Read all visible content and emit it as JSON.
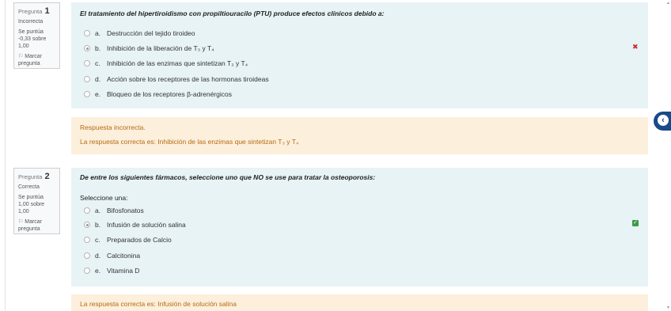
{
  "questions": [
    {
      "label": "Pregunta",
      "number": "1",
      "state": "Incorrecta",
      "grade": "Se puntúa -0,33 sobre 1,00",
      "flag": "Marcar pregunta",
      "text": "El tratamiento del hipertiroidismo con propiltiouracilo (PTU) produce efectos clínicos debido a:",
      "prompt": "",
      "options": [
        {
          "letter": "a.",
          "text": "Destrucción del tejido tiroideo",
          "checked": false
        },
        {
          "letter": "b.",
          "text": "Inhibición de la liberación de T₃ y T₄",
          "checked": true
        },
        {
          "letter": "c.",
          "text": "Inhibición de las enzimas que sintetizan T₃ y T₄",
          "checked": false
        },
        {
          "letter": "d.",
          "text": "Acción sobre los receptores de las hormonas tiroideas",
          "checked": false
        },
        {
          "letter": "e.",
          "text": "Bloqueo de los receptores β-adrenérgicos",
          "checked": false
        }
      ],
      "result_icon": "incorrect-x-icon",
      "feedback": [
        "Respuesta incorrecta.",
        "La respuesta correcta es: Inhibición de las enzimas que sintetizan T₃ y T₄"
      ]
    },
    {
      "label": "Pregunta",
      "number": "2",
      "state": "Correcta",
      "grade": "Se puntúa 1,00 sobre 1,00",
      "flag": "Marcar pregunta",
      "text": "De entre los siguientes fármacos, seleccione uno que NO se use para tratar la osteoporosis:",
      "prompt": "Seleccione una:",
      "options": [
        {
          "letter": "a.",
          "text": "Bifosfonatos",
          "checked": false
        },
        {
          "letter": "b.",
          "text": "Infusión de solución salina",
          "checked": true
        },
        {
          "letter": "c.",
          "text": "Preparados de Calcio",
          "checked": false
        },
        {
          "letter": "d.",
          "text": "Calcitonina",
          "checked": false
        },
        {
          "letter": "e.",
          "text": "Vitamina D",
          "checked": false
        }
      ],
      "result_icon": "correct-check-icon",
      "feedback": [
        "La respuesta correcta es: Infusión de solución salina"
      ]
    }
  ],
  "colors": {
    "formulation_bg": "#e7f3f5",
    "feedback_bg": "#fcefdc",
    "feedback_text": "#b76b12",
    "incorrect": "#c9302c",
    "correct": "#3c9a48",
    "drawer_tab": "#1a4a87"
  }
}
